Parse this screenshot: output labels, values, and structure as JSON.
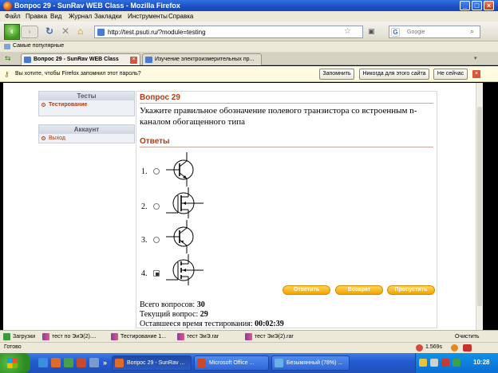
{
  "window": {
    "title": "Вопрос 29 - SunRav WEB Class - Mozilla Firefox",
    "minimize": "_",
    "maximize": "□",
    "close": "×"
  },
  "menu": [
    "Файл",
    "Правка",
    "Вид",
    "Журнал",
    "Закладки",
    "Инструменты",
    "Справка"
  ],
  "nav": {
    "back": "‹",
    "forward": "›",
    "url": "http://test.psuti.ru/?module=testing",
    "search_engine": "G",
    "search_placeholder": "Google"
  },
  "bookmarks": {
    "most_visited": "Самые популярные"
  },
  "tabs": [
    {
      "label": "Вопрос 29 - SunRav WEB Class",
      "active": true
    },
    {
      "label": "Изучение электроизмерительных пр...",
      "active": false
    }
  ],
  "password_bar": {
    "message": "Вы хотите, чтобы Firefox запомнил этот пароль?",
    "remember": "Запомнить",
    "never": "Никогда для этого сайта",
    "not_now": "Не сейчас"
  },
  "sidebar": {
    "tests_header": "Тесты",
    "tests_item": "Тестирование",
    "account_header": "Аккаунт",
    "account_item": "Выход"
  },
  "question": {
    "header": "Вопрос 29",
    "text": "Укажите правильное обозначение полевого транзистора со встроенным n-каналом обогащенного типа",
    "answers_header": "Ответы",
    "answers": [
      {
        "num": "1.",
        "selected": false,
        "symbol": "bipolar-npn"
      },
      {
        "num": "2.",
        "selected": false,
        "symbol": "mosfet-depletion"
      },
      {
        "num": "3.",
        "selected": false,
        "symbol": "bipolar-pnp"
      },
      {
        "num": "4.",
        "selected": true,
        "symbol": "mosfet-enhancement"
      }
    ],
    "buttons": {
      "answer": "Ответить",
      "return": "Возврат",
      "skip": "Пропустить"
    },
    "stats": {
      "total_label": "Всего вопросов:",
      "total_value": "30",
      "current_label": "Текущий вопрос:",
      "current_value": "29",
      "time_label": "Оставшееся время тестирования:",
      "time_value": "00:02:39"
    }
  },
  "downloads": {
    "label": "Загрузки",
    "items": [
      "тест по ЭиЭ(2)....",
      "Тестирование 1...",
      "тест ЭиЭ.rar",
      "тест ЭиЭ(2).rar"
    ],
    "clear": "Очистить"
  },
  "status": {
    "text": "Готово",
    "timing": "1.569s"
  },
  "taskbar": {
    "more": "»",
    "tasks": [
      "Вопрос 29 - SunRav ...",
      "Microsoft Office ...",
      "Безымянный (78%) ..."
    ],
    "clock": "10:28"
  },
  "colors": {
    "accent": "#b33a10",
    "button_orange": "#f2a300",
    "taskbar_blue": "#245cd1"
  }
}
